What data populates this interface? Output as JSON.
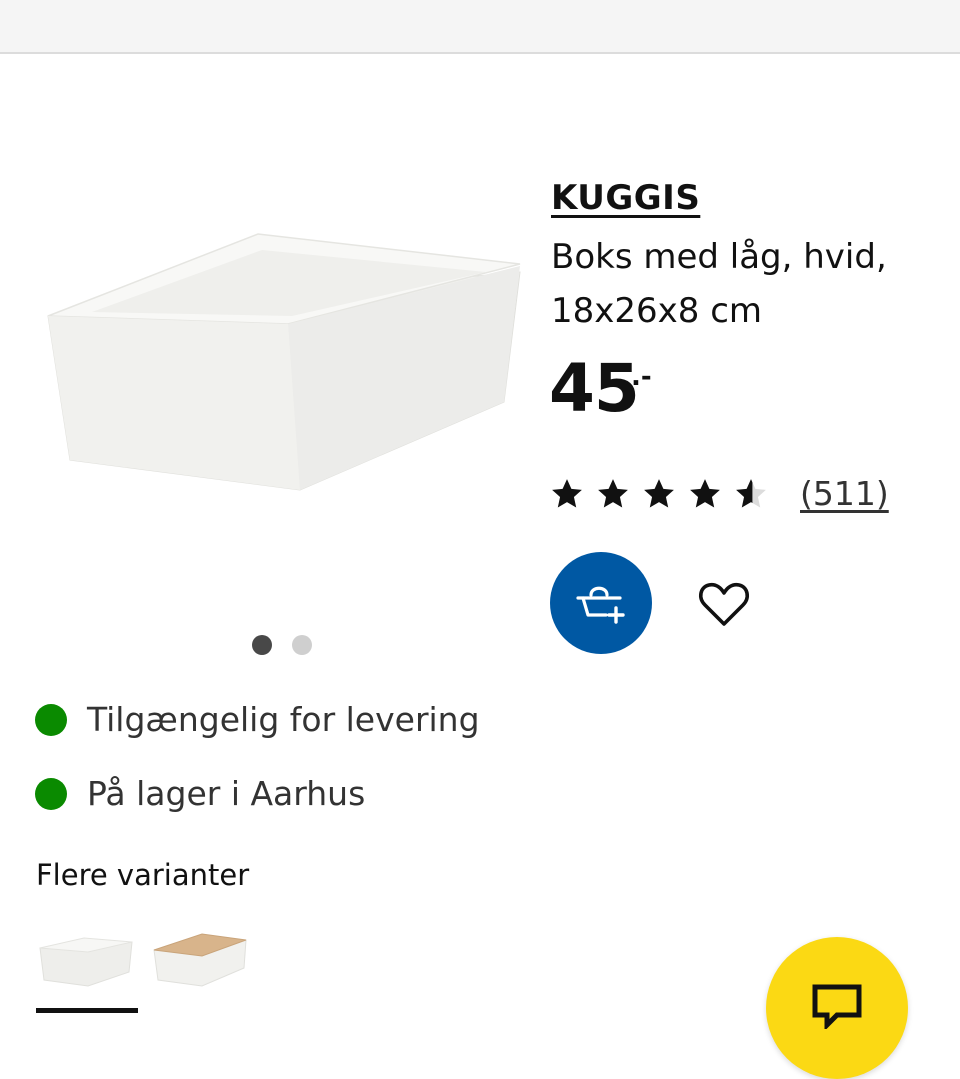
{
  "product": {
    "name": "KUGGIS",
    "description": "Boks med låg, hvid, 18x26x8 cm",
    "price": "45",
    "price_suffix": ".-",
    "rating": {
      "stars": 4.5,
      "max": 5,
      "review_count": "(511)"
    }
  },
  "gallery": {
    "image_icon": "white-storage-box-with-lid",
    "dots_total": 2,
    "active_dot": 1
  },
  "actions": {
    "cart_icon": "add-to-cart-icon",
    "favorite_icon": "heart-icon"
  },
  "availability": [
    {
      "label": "Tilgængelig for levering",
      "status_color": "#0a8a00"
    },
    {
      "label": "På lager i Aarhus",
      "status_color": "#0a8a00"
    }
  ],
  "variants": {
    "title": "Flere varianter",
    "items": [
      {
        "icon": "white-box-white-lid",
        "selected": true
      },
      {
        "icon": "white-box-bamboo-lid",
        "selected": false
      }
    ]
  },
  "chat": {
    "icon": "chat-icon"
  },
  "colors": {
    "primary_blue": "#0058a3",
    "chat_yellow": "#fbd914",
    "stock_green": "#0a8a00"
  }
}
